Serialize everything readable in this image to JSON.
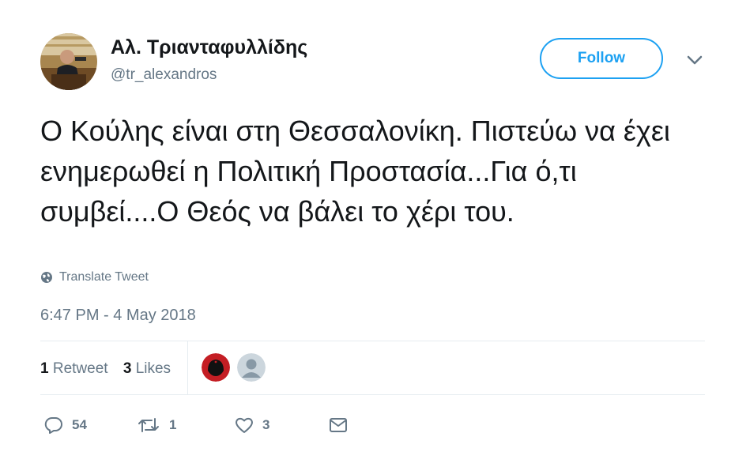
{
  "user": {
    "display_name": "Αλ. Τριανταφυλλίδης",
    "handle": "@tr_alexandros"
  },
  "follow_label": "Follow",
  "tweet": {
    "text": "Ο Κούλης είναι στη Θεσσαλονίκη. Πιστεύω να έχει ενημερωθεί η Πολιτική Προστασία...Για ό,τι συμβεί....Ο Θεός να βάλει το χέρι του.",
    "translate_label": "Translate Tweet",
    "timestamp": "6:47 PM - 4 May 2018"
  },
  "stats": {
    "retweets_count": "1",
    "retweets_label": "Retweet",
    "likes_count": "3",
    "likes_label": "Likes"
  },
  "actions": {
    "reply_count": "54",
    "retweet_count": "1",
    "like_count": "3"
  },
  "colors": {
    "accent": "#1da1f2",
    "secondary_text": "#657786",
    "divider": "#e6ecf0"
  },
  "icons": [
    "chevron-down-icon",
    "globe-icon",
    "reply-icon",
    "retweet-icon",
    "heart-icon",
    "envelope-icon"
  ]
}
